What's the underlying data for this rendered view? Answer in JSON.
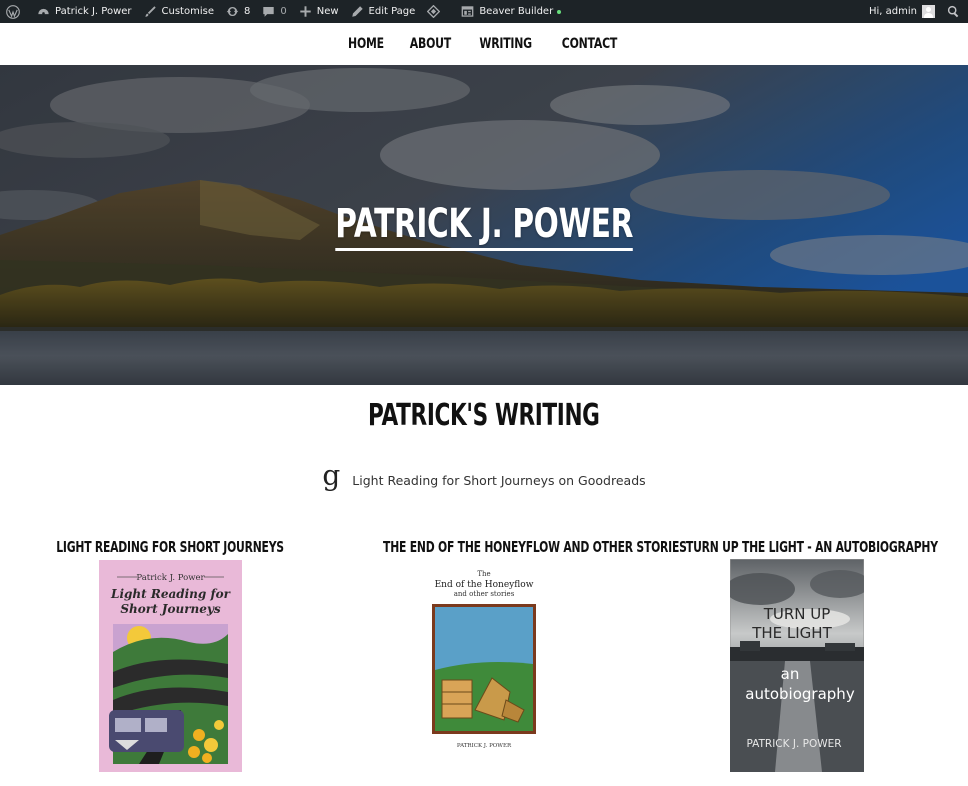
{
  "admin_bar": {
    "site_name": "Patrick J. Power",
    "customise": "Customise",
    "updates_count": "8",
    "comments_count": "0",
    "new_label": "New",
    "edit_page": "Edit Page",
    "builder": "Beaver Builder",
    "greeting": "Hi, admin"
  },
  "nav": {
    "items": [
      "HOME",
      "ABOUT",
      "WRITING",
      "CONTACT"
    ]
  },
  "hero": {
    "title": "PATRICK J. POWER"
  },
  "writing": {
    "title": "PATRICK'S WRITING",
    "goodreads_icon": "g",
    "goodreads_link": "Light Reading for Short Journeys on Goodreads"
  },
  "books": [
    {
      "title": "LIGHT READING FOR SHORT JOURNEYS",
      "cover_author": "Patrick J. Power",
      "cover_title_1": "Light Reading for",
      "cover_title_2": "Short Journeys"
    },
    {
      "title": "THE END OF THE HONEYFLOW AND OTHER STORIES",
      "cover_pre": "The",
      "cover_title": "End of the Honeyflow",
      "cover_sub": "and other stories",
      "cover_author": "PATRICK J. POWER"
    },
    {
      "title": "TURN UP THE LIGHT - AN AUTOBIOGRAPHY",
      "cover_title_1": "TURN UP",
      "cover_title_2": "THE LIGHT",
      "cover_sub_1": "an",
      "cover_sub_2": "autobiography",
      "cover_author": "PATRICK J. POWER"
    }
  ]
}
